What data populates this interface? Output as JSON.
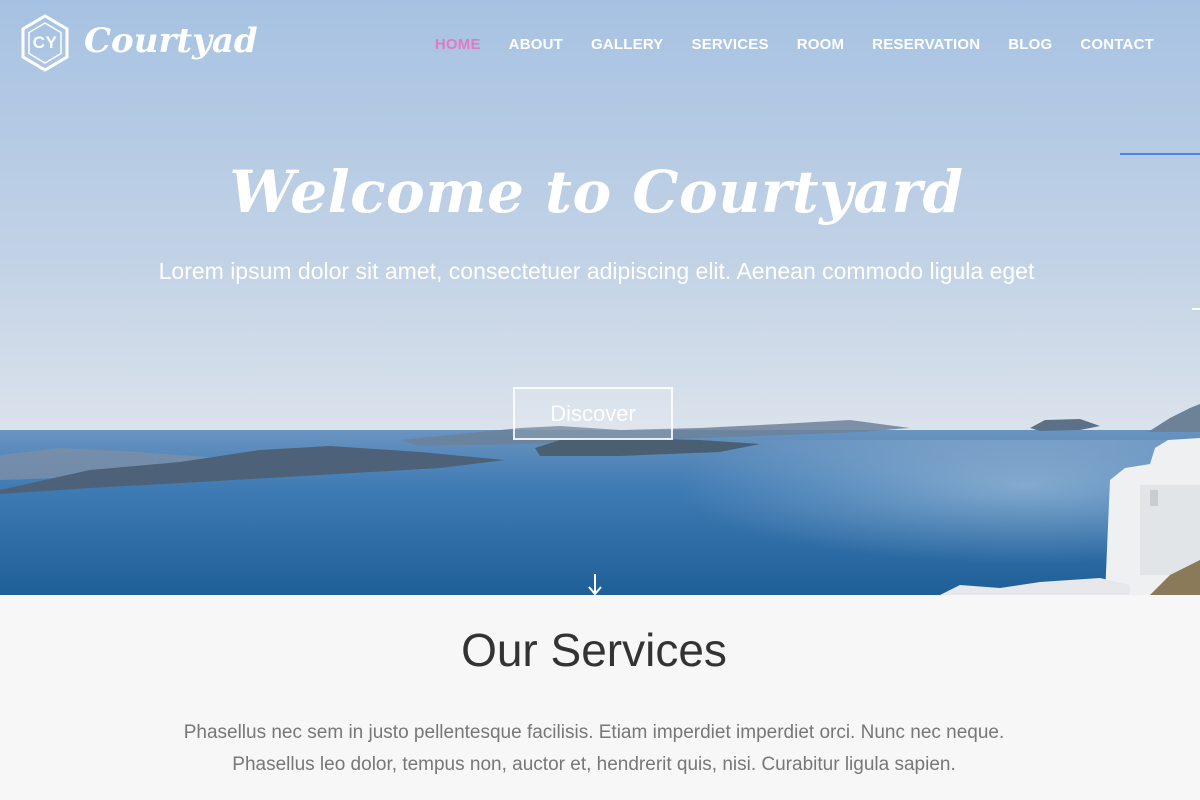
{
  "brand": {
    "monogram": "CY",
    "name": "Courtyad"
  },
  "nav": {
    "items": [
      {
        "label": "HOME",
        "active": true
      },
      {
        "label": "ABOUT"
      },
      {
        "label": "GALLERY"
      },
      {
        "label": "SERVICES"
      },
      {
        "label": "ROOM"
      },
      {
        "label": "RESERVATION"
      },
      {
        "label": "BLOG"
      },
      {
        "label": "CONTACT"
      }
    ]
  },
  "hero": {
    "title": "Welcome to Courtyard",
    "subtitle": "Lorem ipsum dolor sit amet, consectetuer adipiscing elit. Aenean commodo ligula eget",
    "button_label": "Discover"
  },
  "services": {
    "title": "Our Services",
    "line1": "Phasellus nec sem in justo pellentesque facilisis. Etiam imperdiet imperdiet orci. Nunc nec neque.",
    "line2": "Phasellus leo dolor, tempus non, auctor et, hendrerit quis, nisi. Curabitur ligula sapien."
  },
  "colors": {
    "nav_active": "#e07ac4",
    "accent_line": "#4a86e8",
    "sky": "#a9c4e0",
    "sea": "#2f6fa8"
  },
  "icons": {
    "logo": "hexagon-logo-icon",
    "scroll": "arrow-down-icon"
  }
}
